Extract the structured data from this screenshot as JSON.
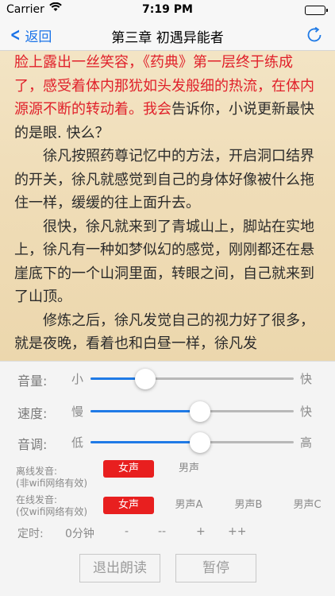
{
  "status": {
    "carrier": "Carrier",
    "time": "7:19 PM"
  },
  "nav": {
    "back_label": "返回",
    "title": "第三章 初遇异能者"
  },
  "reader": {
    "paragraphs": [
      {
        "highlight": "脸上露出一丝笑容，《药典》第一层终于练成了，感受着体内那犹如头发般细的热流，在体内源源不断的转动着。我会",
        "normal": "告诉你，小说更新最快的是眼. 快么？"
      },
      {
        "text": "徐凡按照药尊记忆中的方法，开启洞口结界的开关，徐凡就感觉到自己的身体好像被什么拖住一样，缓缓的往上面升去。"
      },
      {
        "text": "很快，徐凡就来到了青城山上，脚站在实地上，徐凡有一种如梦似幻的感觉，刚刚都还在悬崖底下的一个山洞里面，转眼之间，自己就来到了山顶。"
      },
      {
        "text": "修炼之后，徐凡发觉自己的视力好了很多，就是夜晚，看着也和白昼一样，徐凡发"
      }
    ]
  },
  "controls": {
    "volume": {
      "label": "音量:",
      "low": "小",
      "high": "快",
      "level": 0.27
    },
    "speed": {
      "label": "速度:",
      "low": "慢",
      "high": "快",
      "level": 0.54
    },
    "pitch": {
      "label": "音调:",
      "low": "低",
      "high": "高",
      "level": 0.54
    },
    "offline": {
      "label_line1": "离线发音:",
      "label_line2": "(非wifi网络有效)",
      "options": [
        "女声",
        "男声"
      ]
    },
    "online": {
      "label_line1": "在线发音:",
      "label_line2": "(仅wifi网络有效)",
      "options": [
        "女声",
        "男声A",
        "男声B",
        "男声C"
      ]
    },
    "timer": {
      "label": "定时:",
      "value": "0分钟",
      "minus": "-",
      "minus2": "--",
      "plus": "+",
      "plus2": "++"
    },
    "exit_label": "退出朗读",
    "pause_label": "暂停"
  },
  "colors": {
    "accent": "#1f7ae6",
    "active": "#e81f1f",
    "highlight_text": "#e0202a"
  }
}
